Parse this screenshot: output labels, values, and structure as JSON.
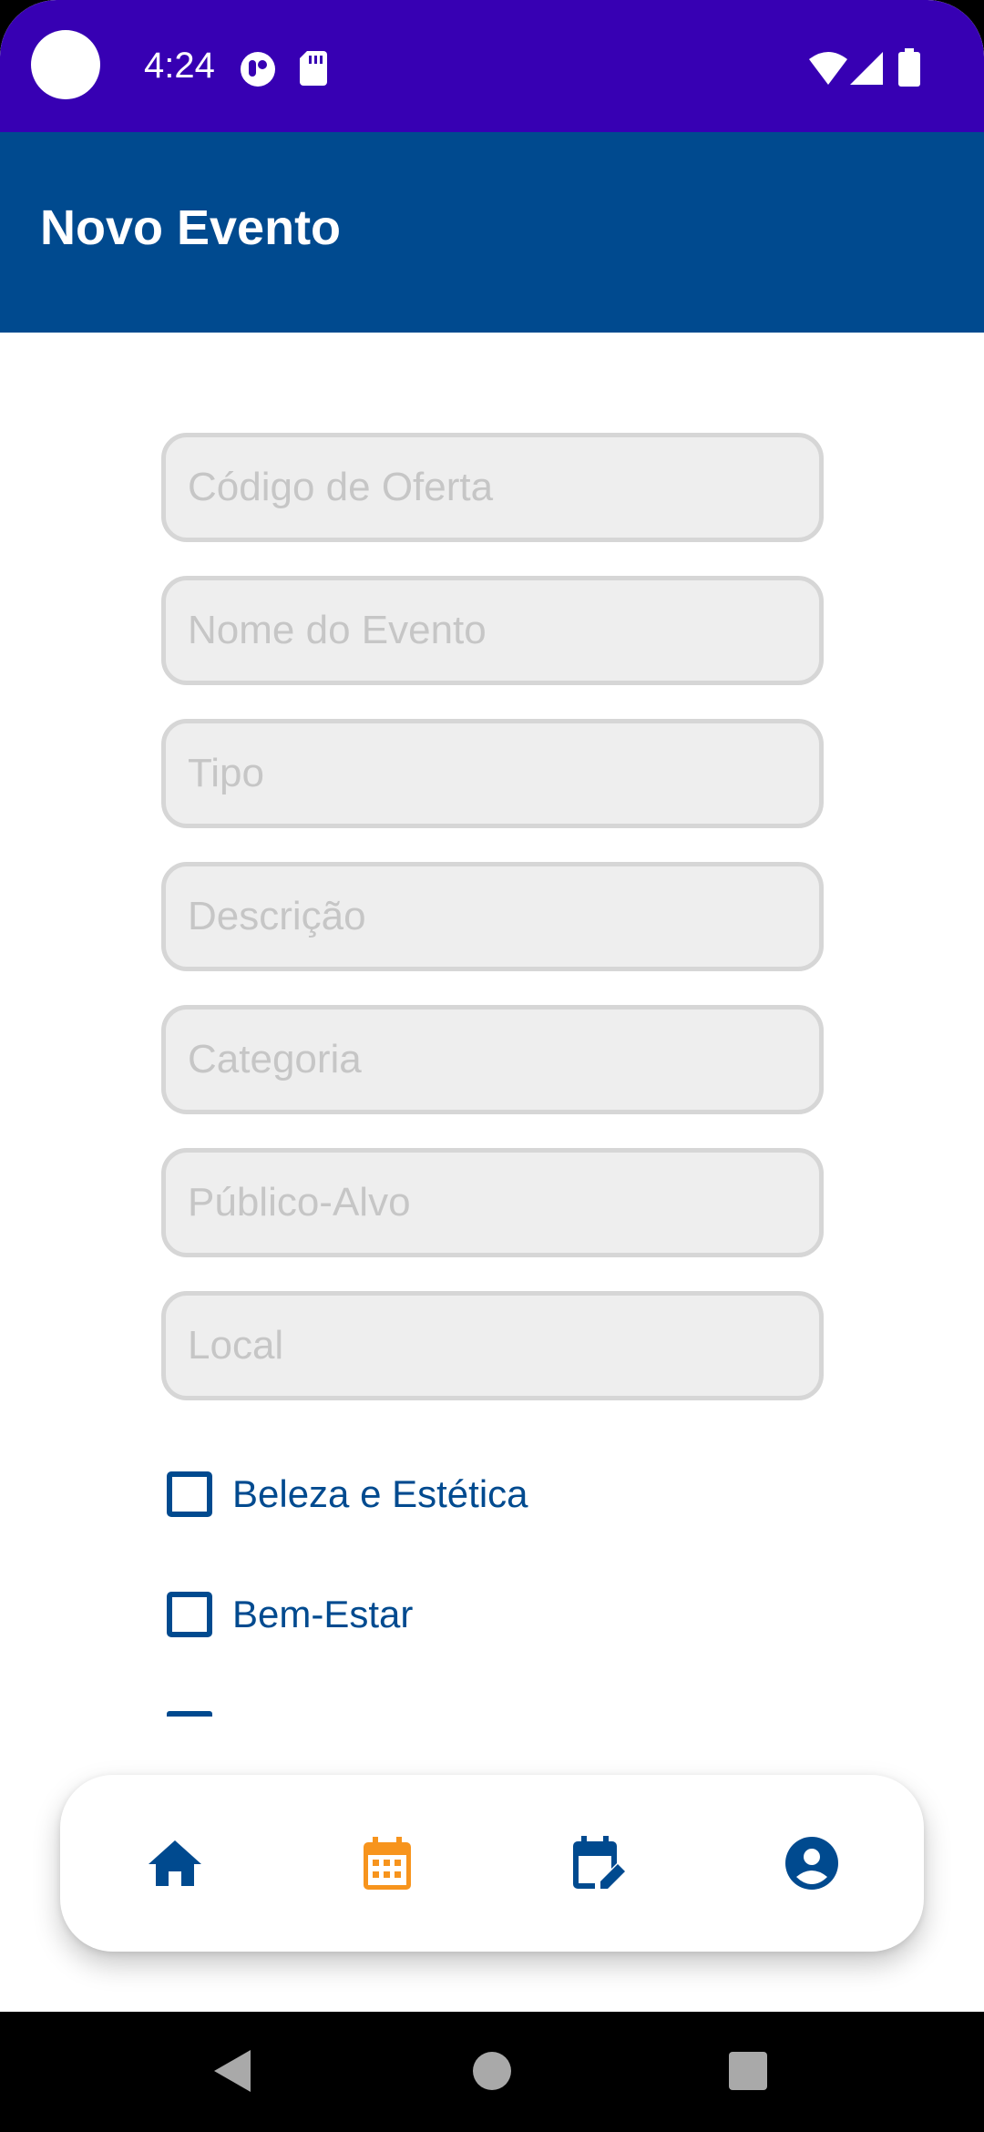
{
  "status_bar": {
    "time": "4:24",
    "background": "#3700b3",
    "icons": [
      "camera-dot",
      "notification-icon",
      "sd-card-icon",
      "wifi-icon",
      "signal-icon",
      "battery-icon"
    ]
  },
  "app_bar": {
    "title": "Novo Evento",
    "background": "#004a8f"
  },
  "form": {
    "fields": [
      {
        "name": "codigo-oferta",
        "placeholder": "Código de Oferta",
        "value": ""
      },
      {
        "name": "nome-evento",
        "placeholder": "Nome do Evento",
        "value": ""
      },
      {
        "name": "tipo",
        "placeholder": "Tipo",
        "value": ""
      },
      {
        "name": "descricao",
        "placeholder": "Descrição",
        "value": ""
      },
      {
        "name": "categoria",
        "placeholder": "Categoria",
        "value": ""
      },
      {
        "name": "publico-alvo",
        "placeholder": "Público-Alvo",
        "value": ""
      },
      {
        "name": "local",
        "placeholder": "Local",
        "value": ""
      }
    ],
    "checkboxes": [
      {
        "label": "Beleza e Estética",
        "checked": false
      },
      {
        "label": "Bem-Estar",
        "checked": false
      }
    ]
  },
  "bottom_nav": {
    "items": [
      {
        "icon": "home-icon",
        "active": false
      },
      {
        "icon": "calendar-icon",
        "active": true
      },
      {
        "icon": "calendar-edit-icon",
        "active": false
      },
      {
        "icon": "account-icon",
        "active": false
      }
    ],
    "active_color": "#f7941d",
    "inactive_color": "#004a8f"
  },
  "system_nav": {
    "buttons": [
      "back-icon",
      "home-circle-icon",
      "recents-icon"
    ]
  }
}
